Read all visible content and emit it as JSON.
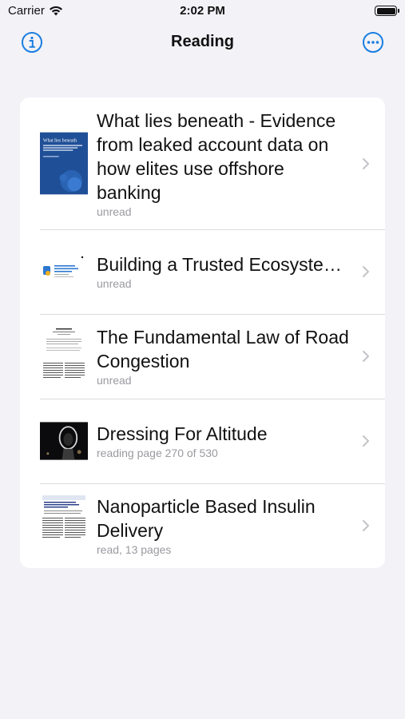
{
  "status_bar": {
    "carrier": "Carrier",
    "time": "2:02 PM"
  },
  "nav": {
    "title": "Reading",
    "info_icon": "info-icon",
    "more_icon": "ellipsis-circle-icon"
  },
  "colors": {
    "accent": "#1a7ee0",
    "background": "#f2f2f7",
    "secondary_text": "#9a9aa0"
  },
  "items": [
    {
      "title": "What lies beneath - Evidence from leaked account data on how elites use offshore banking",
      "status": "unread",
      "thumb_title": "What lies beneath"
    },
    {
      "title": "Building a Trusted Ecosystem for Millions of A...",
      "status": "unread"
    },
    {
      "title": "The Fundamental Law of Road Congestion",
      "status": "unread"
    },
    {
      "title": "Dressing For Altitude",
      "status": "reading page 270 of 530"
    },
    {
      "title": "Nanoparticle Based Insulin Delivery",
      "status": "read, 13 pages"
    }
  ]
}
